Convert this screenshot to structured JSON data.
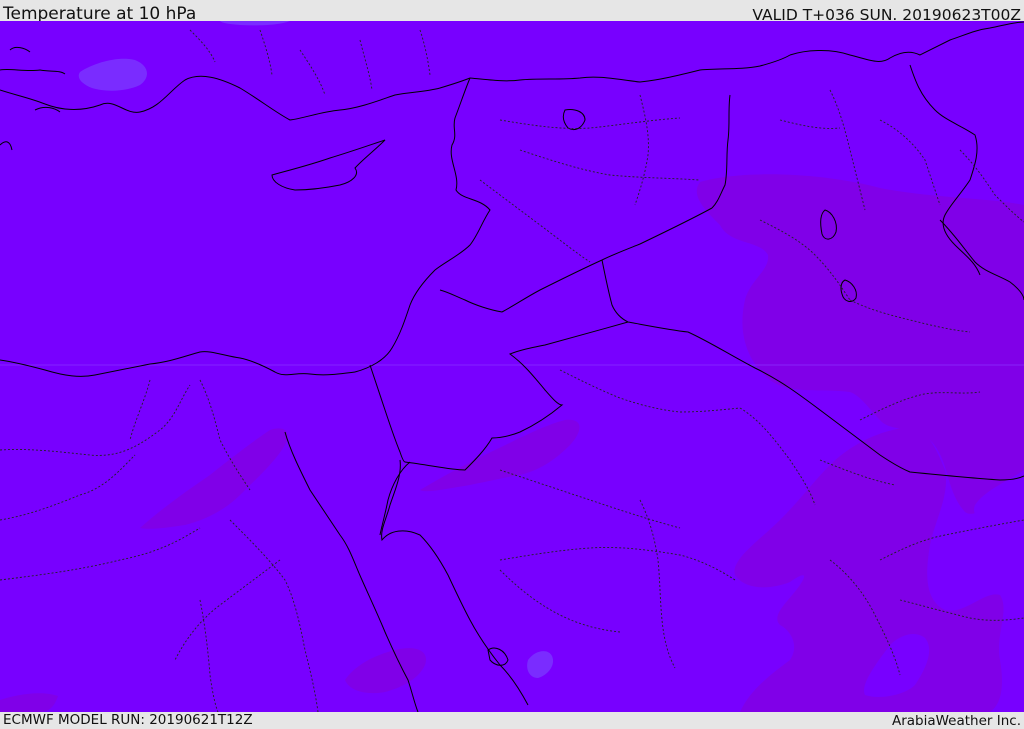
{
  "header": {
    "title": "Temperature at 10 hPa",
    "valid": "VALID T+036 SUN. 20190623T00Z"
  },
  "footer": {
    "model_run": "ECMWF MODEL RUN: 20190621T12Z",
    "brand": "ArabiaWeather Inc."
  },
  "map": {
    "field": "Temperature at 10 hPa",
    "colors": {
      "base": "#7800ff",
      "warmer": "#8000e8",
      "cooler": "#7a2cff",
      "coastline": "#000000",
      "country_border": "#000000",
      "province_border": "#222222",
      "frame_top": "#e6e6e6"
    }
  }
}
